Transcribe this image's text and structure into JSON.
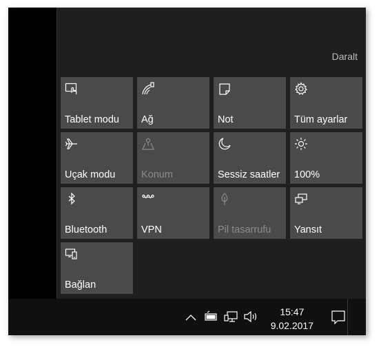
{
  "header": {
    "collapse_label": "Daralt"
  },
  "tiles": [
    {
      "label": "Tablet modu",
      "icon": "tablet-mode-icon",
      "enabled": true
    },
    {
      "label": "Ağ",
      "icon": "network-icon",
      "enabled": true
    },
    {
      "label": "Not",
      "icon": "note-icon",
      "enabled": true
    },
    {
      "label": "Tüm ayarlar",
      "icon": "gear-icon",
      "enabled": true
    },
    {
      "label": "Uçak modu",
      "icon": "airplane-icon",
      "enabled": true
    },
    {
      "label": "Konum",
      "icon": "location-icon",
      "enabled": false
    },
    {
      "label": "Sessiz saatler",
      "icon": "moon-icon",
      "enabled": true
    },
    {
      "label": "100%",
      "icon": "brightness-icon",
      "enabled": true
    },
    {
      "label": "Bluetooth",
      "icon": "bluetooth-icon",
      "enabled": true
    },
    {
      "label": "VPN",
      "icon": "vpn-icon",
      "enabled": true
    },
    {
      "label": "Pil tasarrufu",
      "icon": "battery-saver-icon",
      "enabled": false
    },
    {
      "label": "Yansıt",
      "icon": "project-icon",
      "enabled": true
    },
    {
      "label": "Bağlan",
      "icon": "connect-icon",
      "enabled": true
    }
  ],
  "taskbar": {
    "time": "15:47",
    "date": "9.02.2017",
    "icons": [
      "chevron-up-icon",
      "battery-icon",
      "network-icon",
      "volume-icon",
      "notification-icon"
    ]
  },
  "colors": {
    "tile_bg": "#4a4a4a",
    "panel_bg": "#1f1f1f",
    "taskbar_bg": "#101010",
    "disabled_text": "#8c8c8c"
  }
}
